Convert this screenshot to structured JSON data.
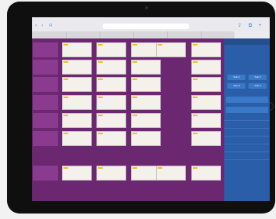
{
  "browser": {
    "url": "",
    "tabs": [
      "",
      "",
      "",
      "",
      "",
      "",
      ""
    ]
  },
  "grid": {
    "rows": [
      {
        "label": "",
        "cards": [
          "",
          "",
          "",
          "",
          ""
        ]
      },
      {
        "label": "",
        "cards": [
          "",
          "",
          "",
          ""
        ]
      },
      {
        "label": "",
        "cards": [
          "",
          "",
          "",
          ""
        ]
      },
      {
        "label": "",
        "cards": [
          "",
          "",
          "",
          ""
        ]
      },
      {
        "label": "",
        "cards": [
          "",
          "",
          "",
          ""
        ]
      },
      {
        "label": "",
        "cards": [
          "",
          "",
          "",
          ""
        ]
      },
      {
        "label": "",
        "cards": [
          "",
          "",
          "",
          "",
          ""
        ]
      }
    ]
  },
  "sidebar": {
    "year_buttons": [
      "Year 1",
      "Year 2",
      "Year 3",
      "Year 4"
    ],
    "selects": [
      "",
      ""
    ],
    "items": [
      "",
      "",
      "",
      "",
      "",
      ""
    ]
  },
  "colors": {
    "background": "#5a1f5e",
    "card": "#f4f0ea",
    "tag": "#f0c020",
    "sidebar": "#2a5ea8"
  }
}
